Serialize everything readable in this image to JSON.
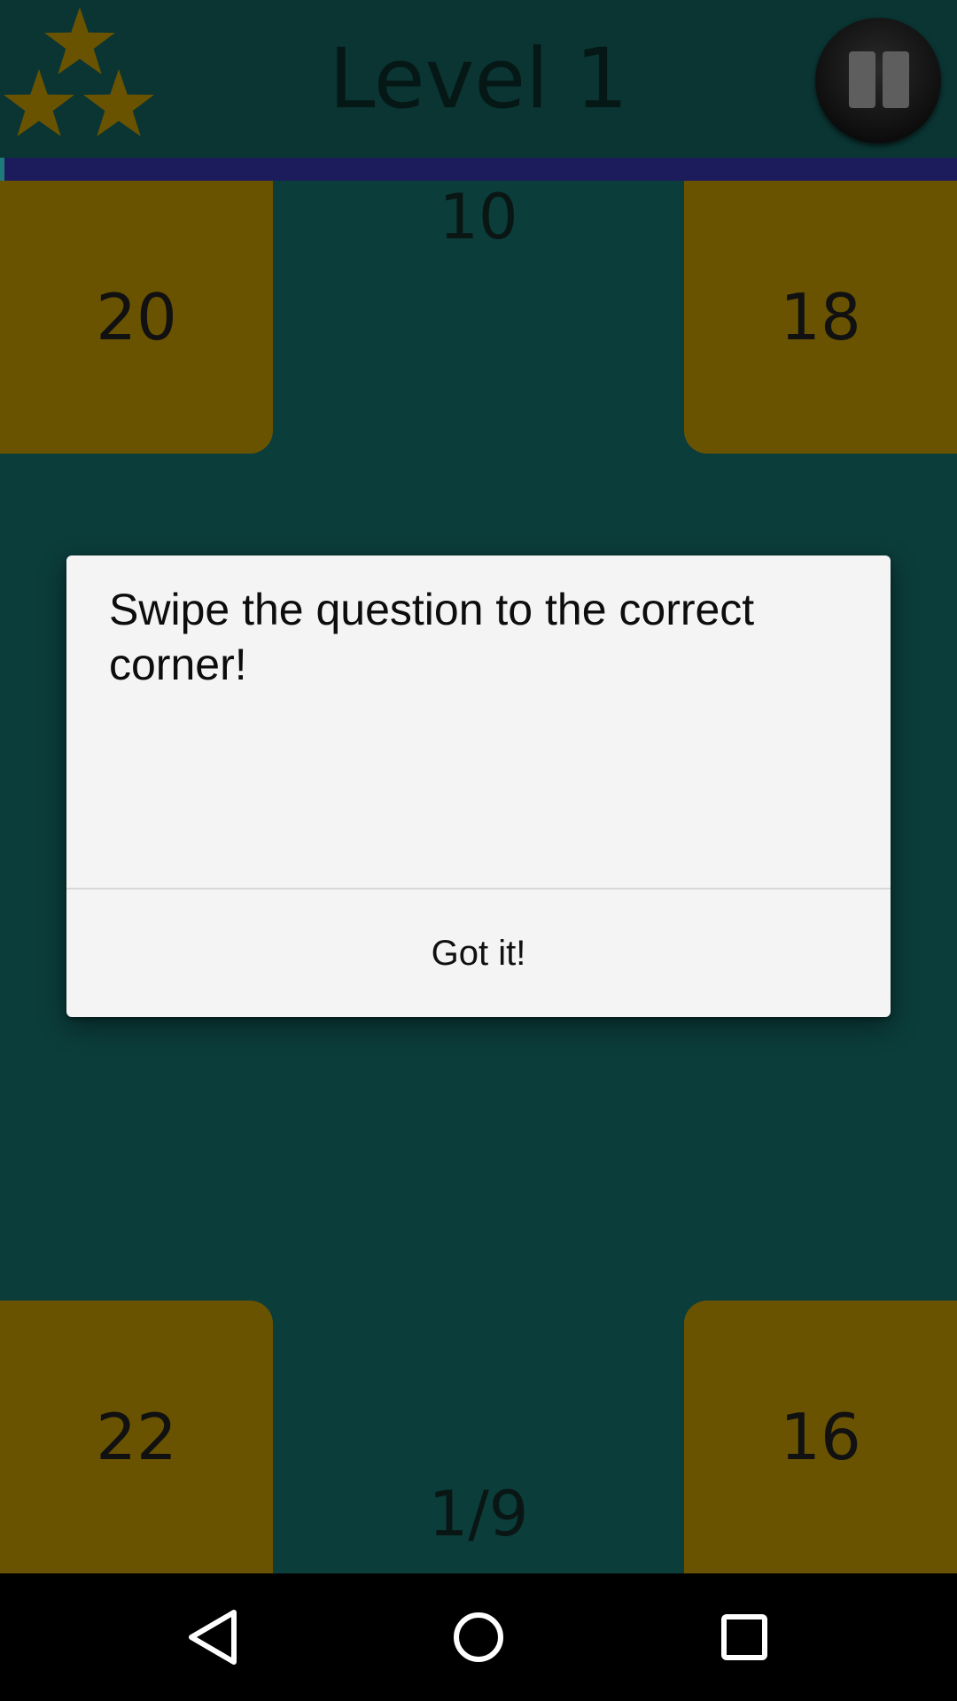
{
  "header": {
    "title": "Level 1",
    "stars_icon": "three-stars-icon",
    "pause_icon": "pause-icon"
  },
  "progress": {
    "fraction": 0.005
  },
  "game": {
    "question": "10",
    "corners": {
      "top_left": "20",
      "top_right": "18",
      "bottom_left": "22",
      "bottom_right": "16"
    },
    "counter": "1/9"
  },
  "dialog": {
    "message": "Swipe the question to the correct corner!",
    "button_label": "Got it!"
  },
  "navbar": {
    "back_icon": "back-triangle-icon",
    "home_icon": "home-circle-icon",
    "recent_icon": "recent-square-icon"
  },
  "colors": {
    "background": "#0b3d3b",
    "corner": "#6a5300",
    "star": "#6a5300",
    "progress_track": "#1c1c5c",
    "dialog": "#f4f4f4"
  }
}
